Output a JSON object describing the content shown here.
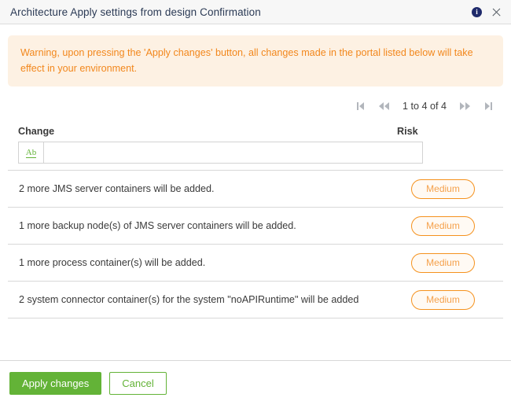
{
  "header": {
    "title": "Architecture Apply settings from design Confirmation",
    "info_icon": "info-icon",
    "info_glyph": "i",
    "close_icon": "close-icon"
  },
  "warning": {
    "text": "Warning, upon pressing the 'Apply changes' button, all changes made in the portal listed below will take effect in your environment."
  },
  "pager": {
    "first_label": "first-page",
    "prev_label": "previous-page",
    "status": "1 to 4 of 4",
    "next_label": "next-page",
    "last_label": "last-page"
  },
  "table": {
    "columns": [
      {
        "key": "change",
        "label": "Change"
      },
      {
        "key": "risk",
        "label": "Risk"
      }
    ],
    "filter": {
      "icon_label": "Ab",
      "value": "",
      "placeholder": ""
    },
    "rows": [
      {
        "change": "2 more JMS server containers will be added.",
        "risk": "Medium"
      },
      {
        "change": "1 more backup node(s) of JMS server containers will be added.",
        "risk": "Medium"
      },
      {
        "change": "1 more process container(s) will be added.",
        "risk": "Medium"
      },
      {
        "change": "2 system connector container(s) for the system \"noAPIRuntime\" will be added",
        "risk": "Medium"
      }
    ]
  },
  "footer": {
    "apply_label": "Apply changes",
    "cancel_label": "Cancel"
  },
  "colors": {
    "accent_green": "#63b337",
    "warning_orange": "#f2871c",
    "badge_border": "#f5921e",
    "badge_bg": "#fffaf4",
    "title_navy": "#2b3a55",
    "header_bg": "#f7f7f7"
  }
}
